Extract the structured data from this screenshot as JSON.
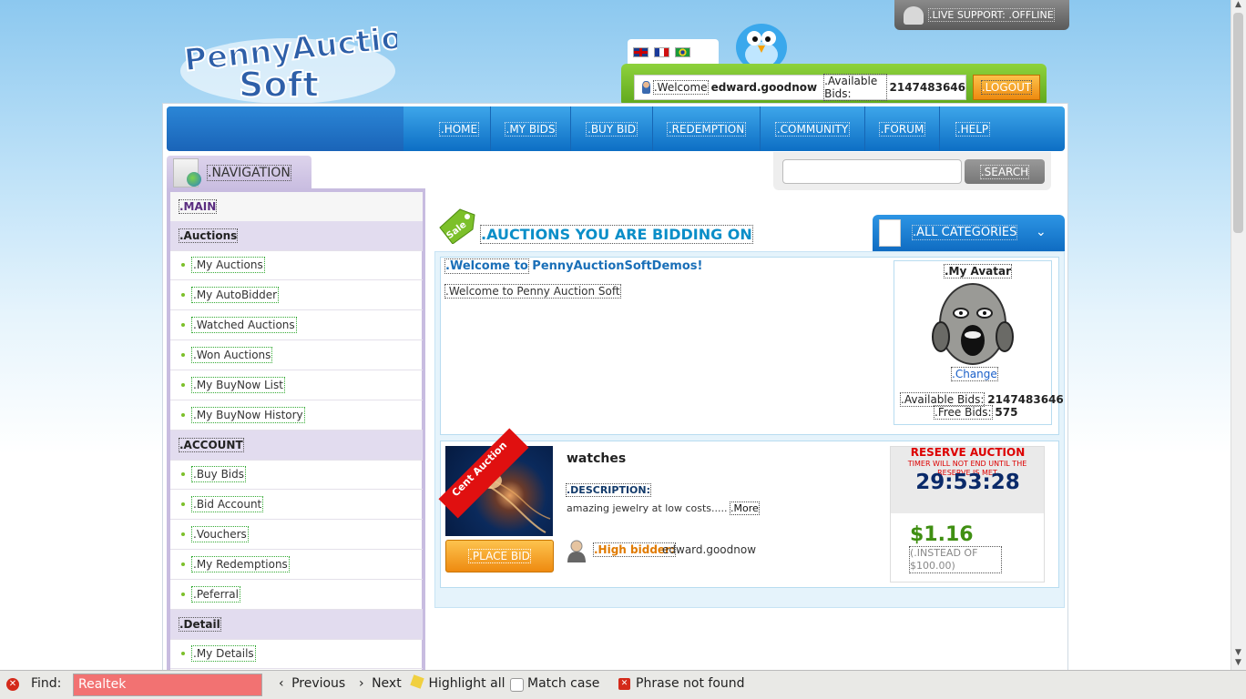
{
  "header": {
    "logo_line1": "PennyAuction",
    "logo_line2": "Soft",
    "live_support": ".LIVE SUPPORT: .OFFLINE",
    "welcome_label": ".Welcome",
    "username": "edward.goodnow",
    "available_bids_label": ".Available Bids:",
    "available_bids": "2147483646",
    "logout_label": ".LOGOUT",
    "flags": [
      "uk-flag-icon",
      "france-flag-icon",
      "brazil-flag-icon"
    ]
  },
  "nav": {
    "items": [
      ".HOME",
      ".MY BIDS",
      ".BUY BID",
      ".REDEMPTION",
      ".COMMUNITY",
      ".FORUM",
      ".HELP"
    ]
  },
  "sidebar": {
    "title": ".NAVIGATION",
    "main": ".MAIN",
    "sections": [
      {
        "header": ".Auctions",
        "items": [
          ".My Auctions",
          ".My AutoBidder",
          ".Watched Auctions",
          ".Won Auctions",
          ".My BuyNow List",
          ".My BuyNow History"
        ]
      },
      {
        "header": ".ACCOUNT",
        "items": [
          ".Buy Bids",
          ".Bid Account",
          ".Vouchers",
          ".My Redemptions",
          ".Peferral"
        ]
      },
      {
        "header": ".Detail",
        "items": [
          ".My Details"
        ]
      }
    ]
  },
  "search": {
    "placeholder": "",
    "button_label": ".SEARCH"
  },
  "main": {
    "sale_tag": "Sale",
    "title": ".AUCTIONS YOU ARE BIDDING ON",
    "category": ".ALL CATEGORIES",
    "welcome_prefix": ".Welcome to",
    "welcome_site": "PennyAuctionSoftDemos!",
    "welcome_message": ".Welcome to Penny Auction Soft",
    "avatar": {
      "title": ".My Avatar",
      "change": ".Change",
      "available_label": ".Available Bids:",
      "available_value": "2147483646",
      "free_label": ".Free Bids:",
      "free_value": "575"
    },
    "auction": {
      "ribbon": "Cent Auction",
      "name": "watches",
      "description_label": ".DESCRIPTION:",
      "description": "amazing jewelry at low costs.....",
      "more": ".More",
      "place_bid": ".PLACE BID",
      "high_bidder_label": ".High bidder:",
      "high_bidder": "edward.goodnow",
      "reserve": "RESERVE AUCTION",
      "reserve_note": "TIMER WILL NOT END UNTIL THE RESERVE IS MET",
      "countdown": "29:53:28",
      "price": "$1.16",
      "instead": "(.INSTEAD OF $100.00)"
    }
  },
  "findbar": {
    "label": "Find:",
    "value": "Realtek",
    "previous": "Previous",
    "next": "Next",
    "highlight": "Highlight all",
    "match_case": "Match case",
    "status": "Phrase not found"
  },
  "colors": {
    "nav_blue": "#1a7fd6",
    "user_bar_green": "#6cb82a",
    "logout_orange": "#f29a1c",
    "sidebar_lilac": "#c8bce0",
    "title_blue": "#0a8ec8",
    "price_green": "#3f8f12",
    "reserve_red": "#dd0000"
  }
}
